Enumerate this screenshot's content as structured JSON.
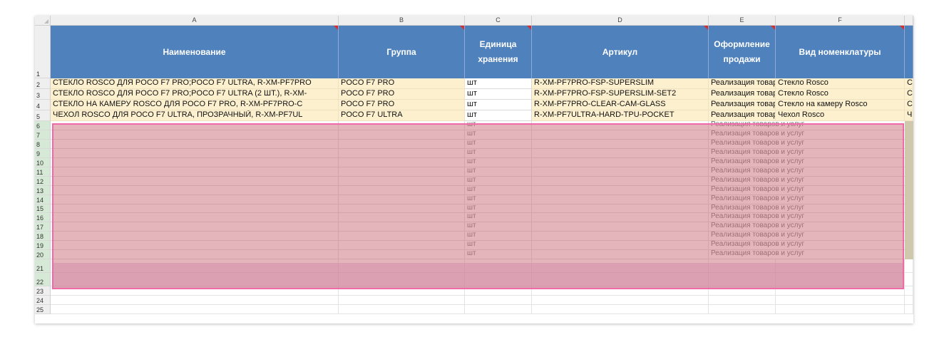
{
  "columns": [
    "A",
    "B",
    "C",
    "D",
    "E",
    "F"
  ],
  "headers": {
    "A": "Наименование",
    "B": "Группа",
    "C": "Единица хранения",
    "D": "Артикул",
    "E": "Оформление продажи",
    "F": "Вид номенклатуры"
  },
  "rows": [
    {
      "num": "2",
      "a": "СТЕКЛО ROSCO ДЛЯ POCO F7 PRO;POCO F7 ULTRA, R-XM-PF7PRO",
      "b": "POCO F7 PRO",
      "c": "шт",
      "d": "R-XM-PF7PRO-FSP-SUPERSLIM",
      "e": "Реализация товаров и услуг",
      "f": "Стекло Rosco",
      "g": "С"
    },
    {
      "num": "3",
      "a": "СТЕКЛО ROSCO ДЛЯ POCO F7 PRO;POCO F7 ULTRA (2 ШТ.), R-XM-",
      "b": "POCO F7 PRO",
      "c": "шт",
      "d": "R-XM-PF7PRO-FSP-SUPERSLIM-SET2",
      "e": "Реализация товаров и услуг",
      "f": "Стекло Rosco",
      "g": "С"
    },
    {
      "num": "4",
      "a": "СТЕКЛО НА КАМЕРУ ROSCO ДЛЯ POCO F7 PRO, R-XM-PF7PRO-C",
      "b": "POCO F7 PRO",
      "c": "шт",
      "d": "R-XM-PF7PRO-CLEAR-CAM-GLASS",
      "e": "Реализация товаров и услуг",
      "f": "Стекло на камеру Rosco",
      "g": "С"
    },
    {
      "num": "5",
      "a": "ЧЕХОЛ ROSCO ДЛЯ POCO F7 ULTRA, ПРОЗРАЧНЫЙ, R-XM-PF7UL",
      "b": "POCO F7 ULTRA",
      "c": "шт",
      "d": "R-XM-PF7ULTRA-HARD-TPU-POCKET",
      "e": "Реализация товаров и услуг",
      "f": "Чехол Rosco",
      "g": "Ч"
    }
  ],
  "empty_rows": [
    "6",
    "7",
    "8",
    "9",
    "10",
    "11",
    "12",
    "13",
    "14",
    "15",
    "16",
    "17",
    "18",
    "19",
    "20"
  ],
  "empty_unit": "шт",
  "empty_sale": "Реализация товаров и услуг",
  "tail_rows": [
    "21",
    "22",
    "23",
    "24",
    "25"
  ]
}
